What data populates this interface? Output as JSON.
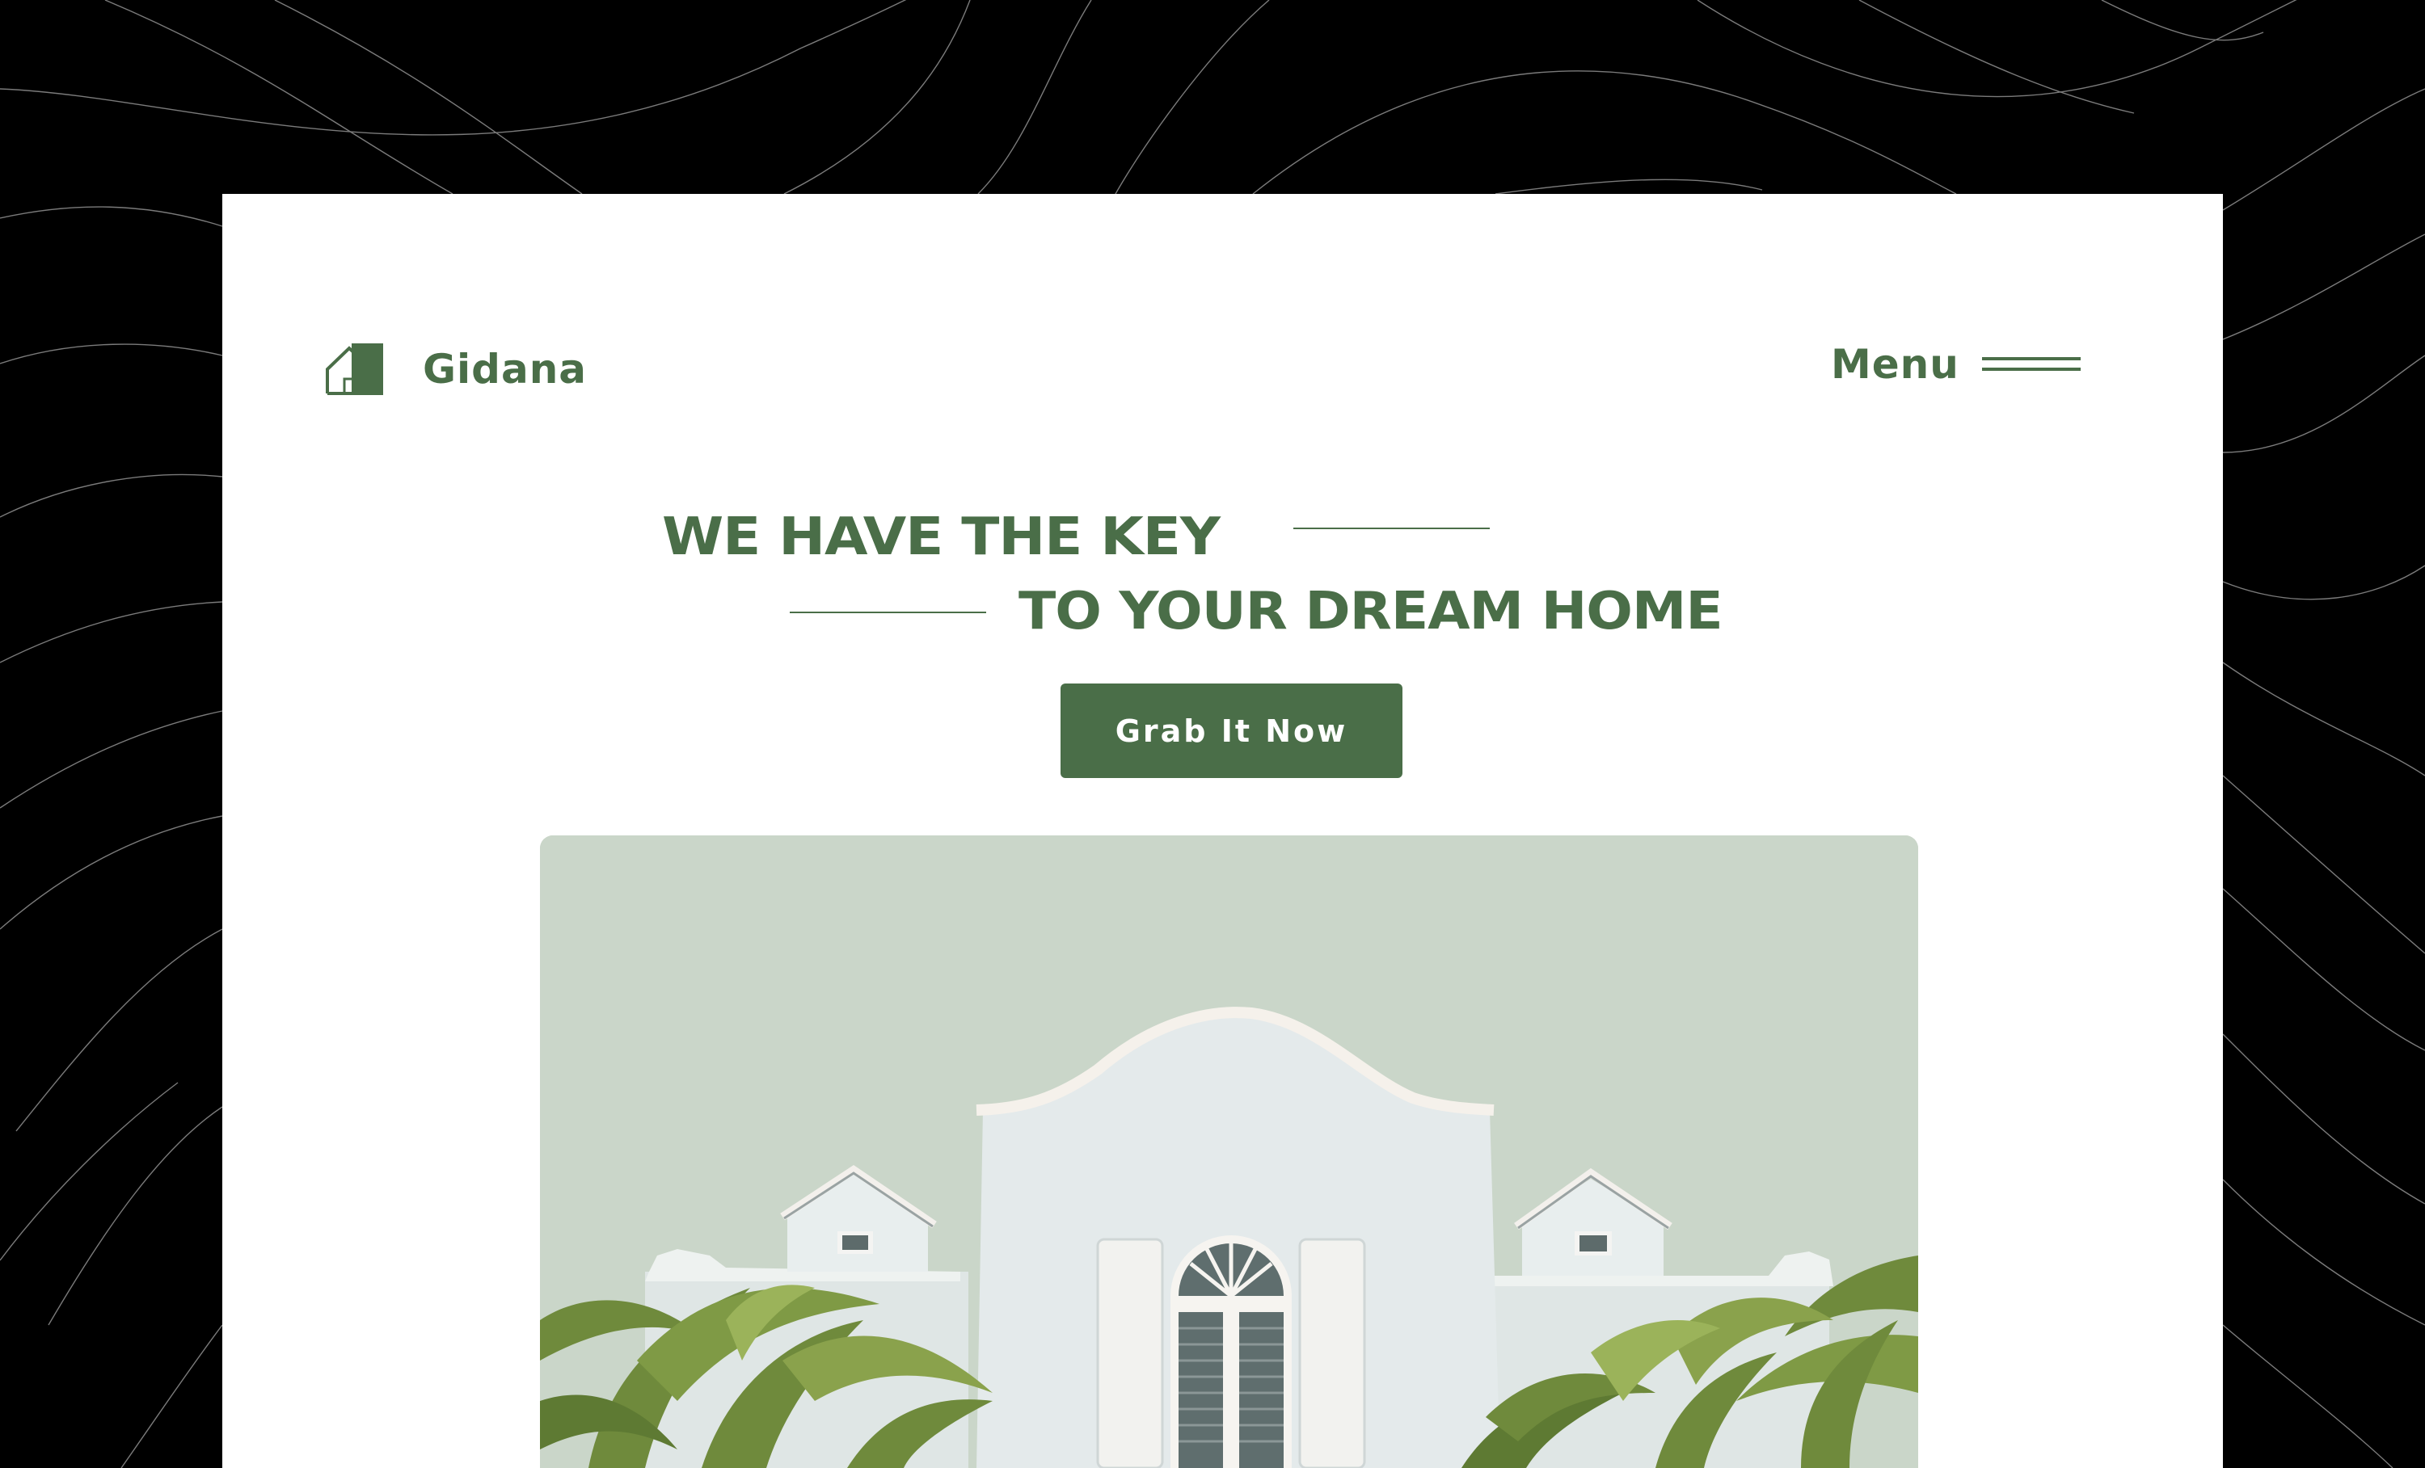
{
  "brand": {
    "name": "Gidana",
    "logo_icon": "house-icon"
  },
  "nav": {
    "menu_label": "Menu",
    "menu_icon": "hamburger-icon"
  },
  "hero": {
    "headline_line1": "WE HAVE THE KEY",
    "headline_line2": "TO YOUR DREAM HOME",
    "cta_label": "Grab It Now",
    "image_alt": "white house with palm trees"
  },
  "colors": {
    "brand_green": "#4a6e48",
    "page_background": "#000000",
    "card_background": "#ffffff",
    "hero_background": "#cad6c9"
  }
}
